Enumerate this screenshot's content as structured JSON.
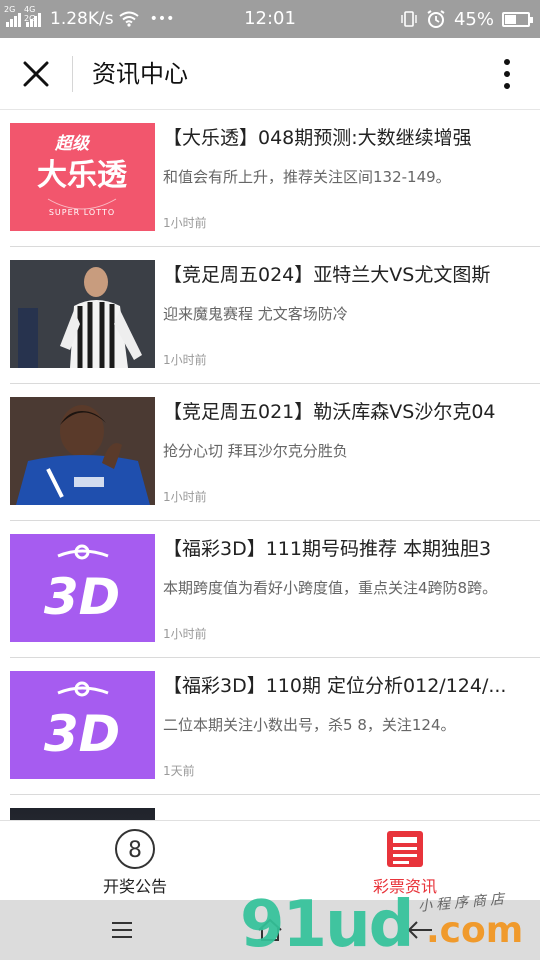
{
  "status_bar": {
    "network_tags": [
      "2G",
      "4G 2G"
    ],
    "speed": "1.28K/s",
    "overflow_dots": "•••",
    "time": "12:01",
    "battery_percent": "45%",
    "battery_level": 0.45
  },
  "header": {
    "title": "资讯中心",
    "close_icon": "close-icon",
    "more_icon": "more-vertical-icon"
  },
  "articles": [
    {
      "thumb_kind": "daletou-logo",
      "thumb_lines": [
        "超级",
        "大乐透",
        "SUPER LOTTO"
      ],
      "title": "【大乐透】048期预测:大数继续增强",
      "summary": "和值会有所上升，推荐关注区间132-149。",
      "time": "1小时前"
    },
    {
      "thumb_kind": "football-photo",
      "title": "【竞足周五024】亚特兰大VS尤文图斯",
      "summary": "迎来魔鬼赛程 尤文客场防冷",
      "time": "1小时前"
    },
    {
      "thumb_kind": "football-photo",
      "title": "【竞足周五021】勒沃库森VS沙尔克04",
      "summary": "抢分心切 拜耳沙尔克分胜负",
      "time": "1小时前"
    },
    {
      "thumb_kind": "fucai-3d-logo",
      "thumb_lines": [
        "3D"
      ],
      "title": "【福彩3D】111期号码推荐 本期独胆3",
      "summary": "本期跨度值为看好小跨度值，重点关注4跨防8跨。",
      "time": "1小时前"
    },
    {
      "thumb_kind": "fucai-3d-logo",
      "thumb_lines": [
        "3D"
      ],
      "title": "【福彩3D】110期 定位分析012/124/...",
      "summary": "二位本期关注小数出号，杀5 8，关注124。",
      "time": "1天前"
    }
  ],
  "tabs": [
    {
      "label": "开奖公告",
      "icon": "lottery-ball-icon",
      "badge": "8",
      "active": false
    },
    {
      "label": "彩票资讯",
      "icon": "news-icon",
      "active": true
    }
  ],
  "nav_bar": {
    "menu_icon": "menu-icon",
    "home_icon": "home-icon",
    "back_icon": "back-arrow-icon"
  },
  "watermark": {
    "main": "91ud",
    "suffix": ".com",
    "tagline": "小程序商店"
  },
  "colors": {
    "status_bar_bg": "#9e9e9e",
    "daletou_bg": "#f2566d",
    "fucai_bg": "#a65cf0",
    "active_tab": "#e8343b",
    "nav_bar_bg": "#dcdcdc"
  }
}
